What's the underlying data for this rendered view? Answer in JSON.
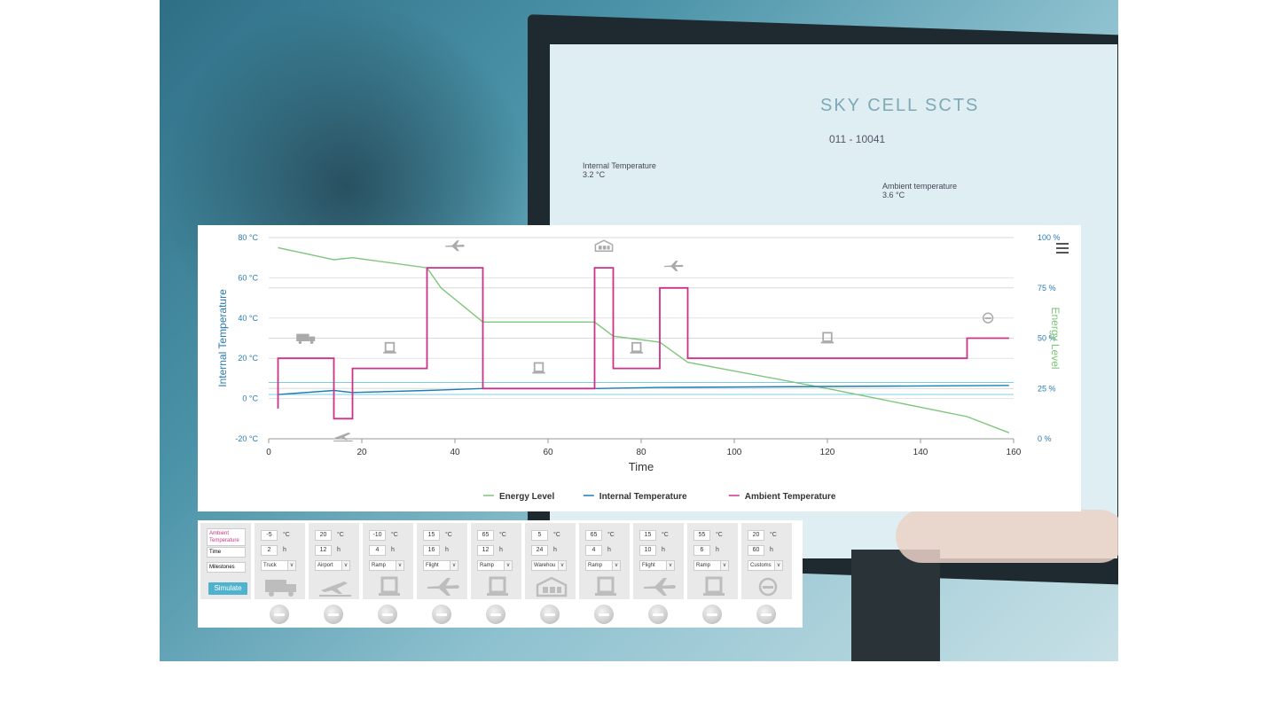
{
  "background": {
    "logo_text": "SKY CELL  SCTS",
    "device_id": "011 - 10041",
    "internal_label": "Internal Temperature",
    "internal_value": "3.2 °C",
    "ambient_label": "Ambient temperature",
    "ambient_value": "3.6 °C"
  },
  "chart_data": {
    "type": "line",
    "xlabel": "Time",
    "ylabel_left": "Internal Temperature",
    "ylabel_right": "Energy Level",
    "xlim": [
      0,
      160
    ],
    "x_ticks": [
      "0",
      "20",
      "40",
      "60",
      "80",
      "100",
      "120",
      "140",
      "160"
    ],
    "ylim_left": [
      -20,
      80
    ],
    "y_left_ticks": [
      "80 °C",
      "60 °C",
      "40 °C",
      "20 °C",
      "0 °C",
      "-20 °C"
    ],
    "ylim_right": [
      0,
      100
    ],
    "y_right_ticks": [
      "100 %",
      "75 %",
      "50 %",
      "25 %",
      "0 %"
    ],
    "grid": true,
    "legend_position": "bottom",
    "colors": {
      "energy": "#7dc67a",
      "internal": "#1a7fb5",
      "ambient": "#cc3388"
    },
    "series": [
      {
        "name": "Energy Level",
        "axis": "right",
        "x": [
          2,
          8,
          14,
          18,
          34,
          37,
          46,
          70,
          74,
          84,
          90,
          120,
          150,
          159
        ],
        "y": [
          95,
          92,
          89,
          90,
          85,
          75,
          58,
          58,
          51,
          48,
          38,
          25,
          11,
          3
        ]
      },
      {
        "name": "Internal Temperature",
        "axis": "left",
        "x": [
          2,
          14,
          18,
          34,
          46,
          70,
          84,
          120,
          159
        ],
        "y": [
          2,
          4,
          3,
          4,
          5,
          5,
          5.5,
          6,
          6.5
        ]
      },
      {
        "name": "Ambient Temperature",
        "axis": "left",
        "x": [
          2,
          2,
          14,
          14,
          18,
          18,
          34,
          34,
          46,
          46,
          70,
          70,
          74,
          74,
          84,
          84,
          90,
          90,
          150,
          150,
          159
        ],
        "y": [
          -5,
          20,
          20,
          -10,
          -10,
          15,
          15,
          65,
          65,
          5,
          5,
          65,
          65,
          15,
          15,
          55,
          55,
          20,
          20,
          30,
          30
        ]
      }
    ],
    "reference_bands": [
      8,
      2
    ],
    "milestone_icons": [
      "truck",
      "airport",
      "ramp",
      "flight",
      "ramp",
      "warehouse",
      "ramp",
      "flight",
      "ramp",
      "customs"
    ]
  },
  "controls": {
    "labels": [
      "Ambient Temperature",
      "Time",
      "Milestones"
    ],
    "simulate_label": "Simulate",
    "temp_unit": "°C",
    "time_unit": "h",
    "steps": [
      {
        "temp": "-5",
        "time": "2",
        "milestone": "Truck",
        "icon": "truck-icon"
      },
      {
        "temp": "20",
        "time": "12",
        "milestone": "Airport",
        "icon": "airport-icon"
      },
      {
        "temp": "-10",
        "time": "4",
        "milestone": "Ramp",
        "icon": "ramp-icon"
      },
      {
        "temp": "15",
        "time": "16",
        "milestone": "Flight",
        "icon": "flight-icon"
      },
      {
        "temp": "65",
        "time": "12",
        "milestone": "Ramp",
        "icon": "ramp-icon"
      },
      {
        "temp": "5",
        "time": "24",
        "milestone": "Warehou",
        "icon": "warehouse-icon"
      },
      {
        "temp": "65",
        "time": "4",
        "milestone": "Ramp",
        "icon": "ramp-icon"
      },
      {
        "temp": "15",
        "time": "10",
        "milestone": "Flight",
        "icon": "flight-icon"
      },
      {
        "temp": "55",
        "time": "6",
        "milestone": "Ramp",
        "icon": "ramp-icon"
      },
      {
        "temp": "20",
        "time": "60",
        "milestone": "Customs",
        "icon": "customs-icon"
      }
    ]
  }
}
